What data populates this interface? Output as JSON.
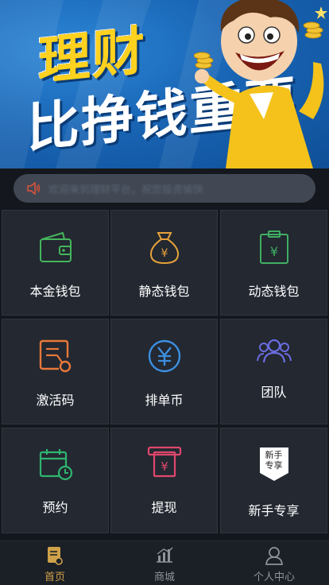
{
  "banner": {
    "line1": "理财",
    "line2": "比挣钱重要"
  },
  "notice": {
    "icon": "speaker-icon",
    "text": "欢迎来到理财平台，祝您投资愉快"
  },
  "grid": [
    {
      "label": "本金钱包",
      "icon": "wallet-icon",
      "color": "#46b55c"
    },
    {
      "label": "静态钱包",
      "icon": "money-bag-icon",
      "color": "#e6a03a"
    },
    {
      "label": "动态钱包",
      "icon": "clipboard-yen-icon",
      "color": "#3fae63"
    },
    {
      "label": "激活码",
      "icon": "activation-code-icon",
      "color": "#e8783a"
    },
    {
      "label": "排单币",
      "icon": "yen-coin-icon",
      "color": "#3d8fe0"
    },
    {
      "label": "团队",
      "icon": "team-icon",
      "color": "#6a6de0"
    },
    {
      "label": "预约",
      "icon": "calendar-clock-icon",
      "color": "#2fb56f"
    },
    {
      "label": "提现",
      "icon": "withdraw-atm-icon",
      "color": "#e0476d"
    },
    {
      "label": "新手专享",
      "icon": "newbie-badge-icon",
      "badge_text_1": "新手",
      "badge_text_2": "专享"
    }
  ],
  "tabs": [
    {
      "label": "首页",
      "icon": "home-doc-icon",
      "active": true
    },
    {
      "label": "商城",
      "icon": "chart-mall-icon",
      "active": false
    },
    {
      "label": "个人中心",
      "icon": "user-icon",
      "active": false
    }
  ],
  "colors": {
    "accent": "#cfa24a",
    "background": "#14171d",
    "cell": "#232831"
  }
}
